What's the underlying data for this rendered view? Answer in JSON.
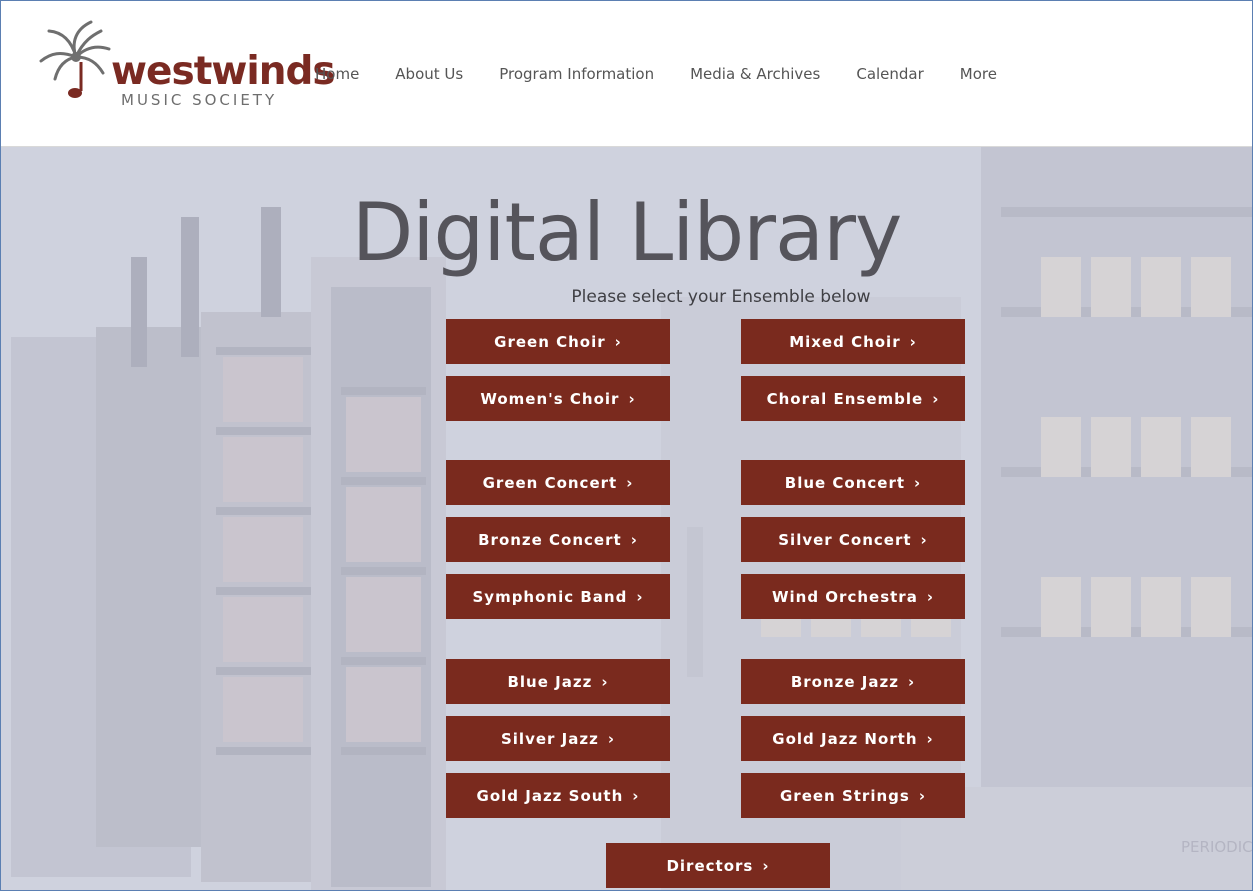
{
  "header": {
    "logo_word": "westwinds",
    "logo_sub": "MUSIC SOCIETY",
    "nav": [
      "Home",
      "About Us",
      "Program Information",
      "Media & Archives",
      "Calendar",
      "More"
    ]
  },
  "hero": {
    "title": "Digital Library",
    "subtitle": "Please select your Ensemble below",
    "shelf_label": "PERIODIC"
  },
  "ensembles": {
    "choirs": [
      "Green Choir",
      "Mixed Choir",
      "Women's Choir",
      "Choral Ensemble"
    ],
    "concert": [
      "Green Concert",
      "Blue Concert",
      "Bronze Concert",
      "Silver Concert",
      "Symphonic Band",
      "Wind Orchestra"
    ],
    "jazz": [
      "Blue Jazz",
      "Bronze Jazz",
      "Silver Jazz",
      "Gold Jazz North",
      "Gold Jazz South",
      "Green Strings"
    ],
    "directors": "Directors"
  },
  "icons": {
    "chevron": "›"
  },
  "colors": {
    "brand": "#7a2a1e",
    "nav_text": "#555555",
    "title": "#55545b"
  }
}
